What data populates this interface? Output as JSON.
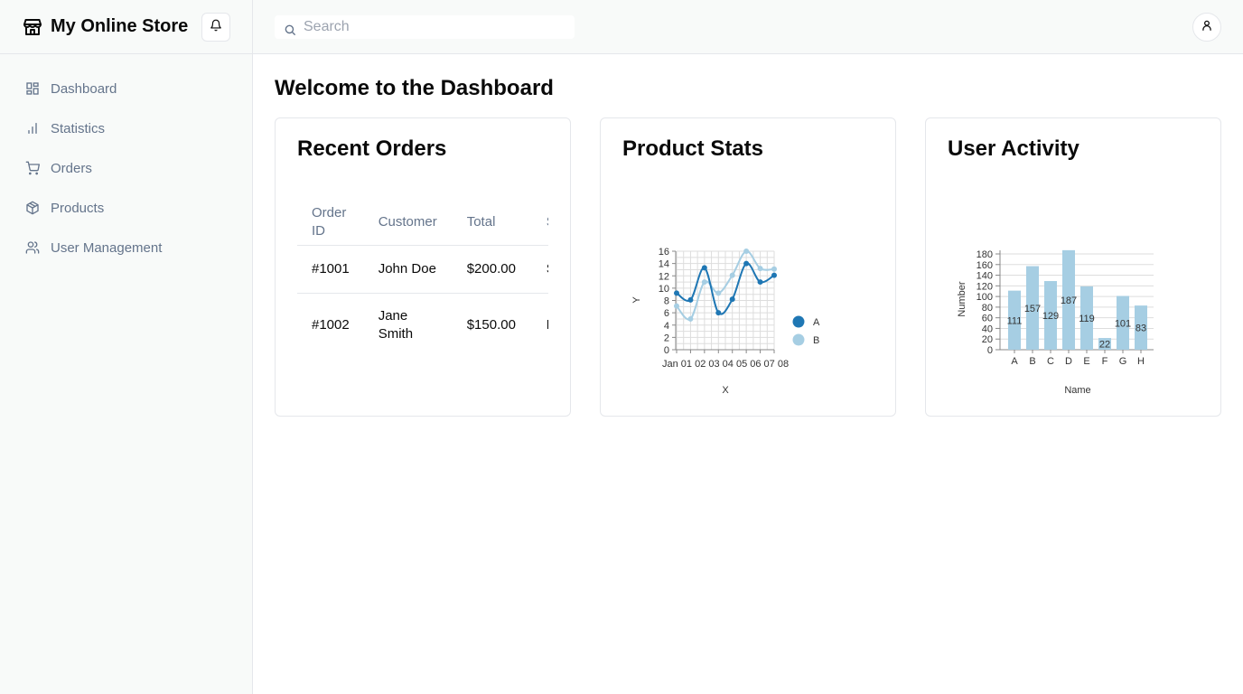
{
  "brand": {
    "title": "My Online Store"
  },
  "sidebar": {
    "items": [
      {
        "label": "Dashboard",
        "icon": "dashboard-icon"
      },
      {
        "label": "Statistics",
        "icon": "bar-chart-icon"
      },
      {
        "label": "Orders",
        "icon": "cart-icon"
      },
      {
        "label": "Products",
        "icon": "package-icon"
      },
      {
        "label": "User Management",
        "icon": "users-icon"
      }
    ]
  },
  "search": {
    "placeholder": "Search",
    "value": ""
  },
  "page": {
    "title": "Welcome to the Dashboard"
  },
  "cards": {
    "orders": {
      "title": "Recent Orders",
      "columns": [
        "Order ID",
        "Customer",
        "Total",
        "S"
      ],
      "rows": [
        [
          "#1001",
          "John Doe",
          "$200.00",
          "S"
        ],
        [
          "#1002",
          "Jane Smith",
          "$150.00",
          "P"
        ]
      ]
    },
    "product_stats": {
      "title": "Product Stats"
    },
    "user_activity": {
      "title": "User Activity"
    }
  },
  "colors": {
    "series_a": "#1f77b4",
    "series_b": "#a6cee3",
    "bar": "#a6cee3",
    "grid": "#dddddd"
  },
  "chart_data": [
    {
      "type": "line",
      "title": "",
      "xlabel": "X",
      "ylabel": "Y",
      "x": [
        "Jan 01",
        "02",
        "03",
        "04",
        "05",
        "06",
        "07",
        "08"
      ],
      "x_tick_text": "Jan 01 02 03 04 05 06 07 08",
      "ylim": [
        0,
        16
      ],
      "yticks": [
        0,
        2,
        4,
        6,
        8,
        10,
        12,
        14,
        16
      ],
      "legend": "right",
      "series": [
        {
          "name": "A",
          "values": [
            9.2,
            8.1,
            13.3,
            6.0,
            8.2,
            14.0,
            11.0,
            12.1
          ]
        },
        {
          "name": "B",
          "values": [
            7.1,
            5.0,
            11.0,
            9.2,
            12.1,
            16.0,
            13.2,
            13.1
          ]
        }
      ]
    },
    {
      "type": "bar",
      "title": "",
      "xlabel": "Name",
      "ylabel": "Number",
      "categories": [
        "A",
        "B",
        "C",
        "D",
        "E",
        "F",
        "G",
        "H"
      ],
      "values": [
        111,
        157,
        129,
        187,
        119,
        22,
        101,
        83
      ],
      "ylim": [
        0,
        180
      ],
      "yticks": [
        0,
        20,
        40,
        60,
        80,
        100,
        120,
        140,
        160,
        180
      ]
    }
  ]
}
